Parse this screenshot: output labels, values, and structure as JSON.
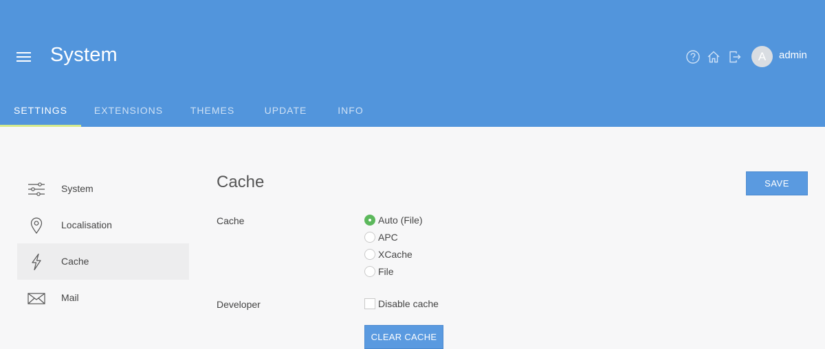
{
  "header": {
    "title": "System",
    "user": {
      "initial": "A",
      "name": "admin"
    },
    "icons": [
      "help-icon",
      "home-icon",
      "logout-icon"
    ]
  },
  "tabs": [
    {
      "label": "SETTINGS",
      "active": true
    },
    {
      "label": "EXTENSIONS",
      "active": false
    },
    {
      "label": "THEMES",
      "active": false
    },
    {
      "label": "UPDATE",
      "active": false
    },
    {
      "label": "INFO",
      "active": false
    }
  ],
  "sidebar": {
    "items": [
      {
        "label": "System",
        "icon": "sliders-icon",
        "active": false
      },
      {
        "label": "Localisation",
        "icon": "map-pin-icon",
        "active": false
      },
      {
        "label": "Cache",
        "icon": "lightning-icon",
        "active": true
      },
      {
        "label": "Mail",
        "icon": "envelope-icon",
        "active": false
      }
    ]
  },
  "main": {
    "title": "Cache",
    "save_label": "SAVE",
    "cache_field": {
      "label": "Cache",
      "options": [
        {
          "label": "Auto (File)",
          "selected": true
        },
        {
          "label": "APC",
          "selected": false
        },
        {
          "label": "XCache",
          "selected": false
        },
        {
          "label": "File",
          "selected": false
        }
      ]
    },
    "developer_field": {
      "label": "Developer",
      "checkbox_label": "Disable cache",
      "checked": false
    },
    "clear_label": "CLEAR CACHE"
  },
  "colors": {
    "header_bg": "#5295dc",
    "tab_indicator": "#d4e98b",
    "button_bg": "#5a9ae0",
    "radio_selected": "#5cb85c"
  }
}
